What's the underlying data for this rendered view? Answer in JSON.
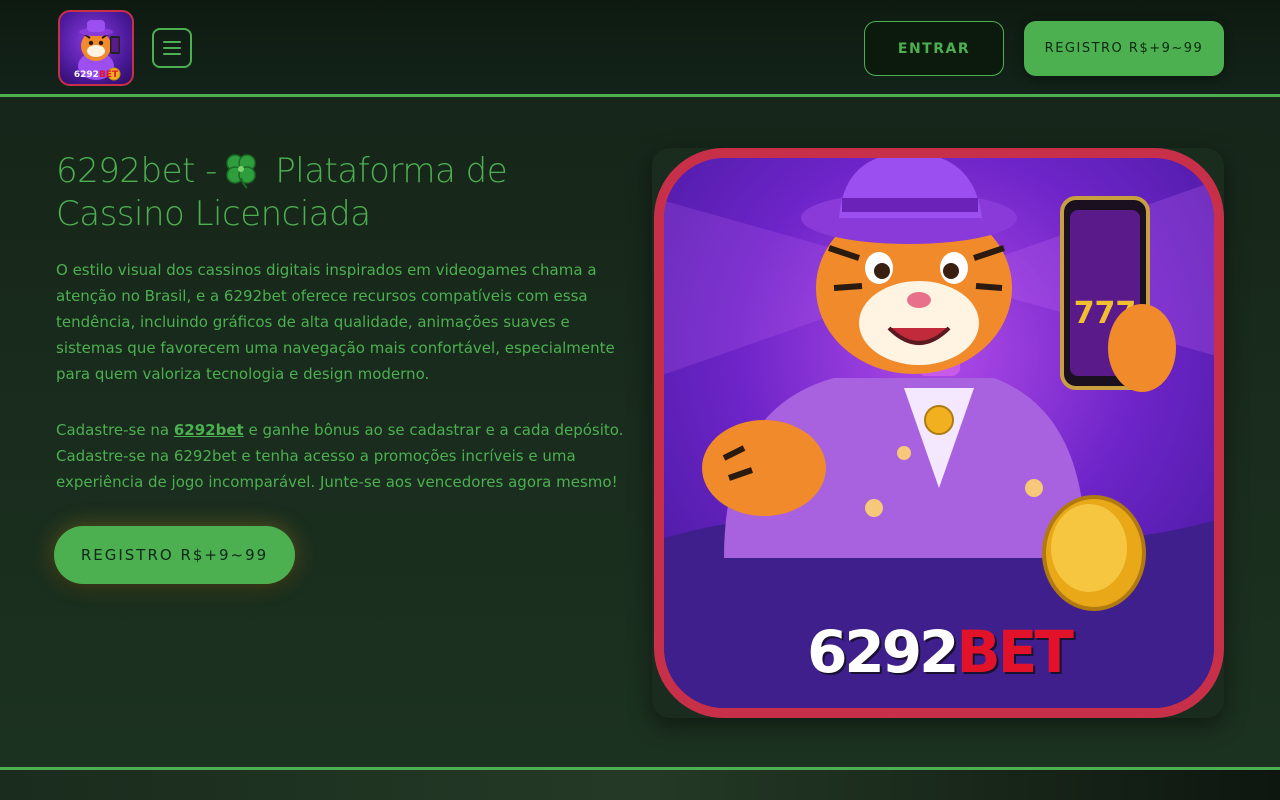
{
  "header": {
    "logo_text_white": "6292",
    "logo_text_red": "BET",
    "menu_icon": "hamburger-menu-icon",
    "login_label": "ENTRAR",
    "register_label": "REGISTRO R$+9~99"
  },
  "main": {
    "title_before": "6292bet -",
    "title_after": " Plataforma de Cassino Licenciada",
    "title_icon": "four-leaf-clover-icon",
    "paragraph1": "O estilo visual dos cassinos digitais inspirados em videogames chama a atenção no Brasil, e a 6292bet oferece recursos compatíveis com essa tendência, incluindo gráficos de alta qualidade, animações suaves e sistemas que favorecem uma navegação mais confortável, especialmente para quem valoriza tecnologia e design moderno.",
    "paragraph2_before": "Cadastre-se na ",
    "paragraph2_link": "6292bet",
    "paragraph2_after": " e ganhe bônus ao se cadastrar e a cada depósito. Cadastre-se na 6292bet e tenha acesso a promoções incríveis e uma experiência de jogo incomparável. Junte-se aos vencedores agora mesmo!",
    "cta_label": "REGISTRO R$+9~99"
  },
  "hero": {
    "brand_white": "6292",
    "brand_red": "BET",
    "phone_badge": "777"
  },
  "colors": {
    "accent": "#4caf50",
    "background": "#16261a",
    "brand_red": "#e3122b",
    "frame_red": "#c8304a"
  }
}
